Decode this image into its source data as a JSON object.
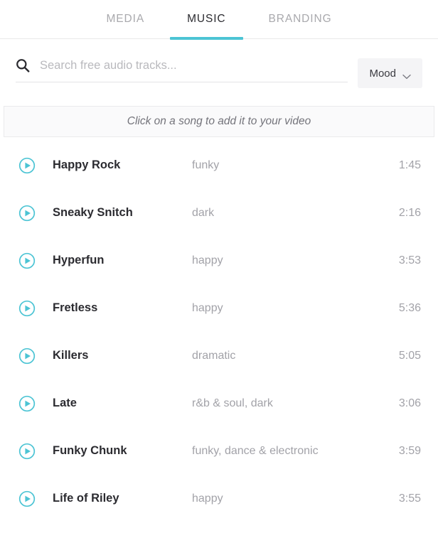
{
  "colors": {
    "accent": "#4cc4d4",
    "text_dark": "#2b2b30",
    "text_muted": "#a2a2a8",
    "tab_inactive": "#a9a9ad",
    "border": "#e9e9e9",
    "banner_bg": "#fafafb",
    "mood_btn_bg": "#f4f4f6"
  },
  "tabs": [
    {
      "label": "MEDIA",
      "active": false
    },
    {
      "label": "MUSIC",
      "active": true
    },
    {
      "label": "BRANDING",
      "active": false
    }
  ],
  "search": {
    "icon": "search-icon",
    "value": "",
    "placeholder": "Search free audio tracks..."
  },
  "filter": {
    "label": "Mood",
    "icon": "chevron-down-icon"
  },
  "hint": {
    "text": "Click on a song to add it to your video"
  },
  "tracks": [
    {
      "play_icon": "play-circle-icon",
      "title": "Happy Rock",
      "mood": "funky",
      "duration": "1:45"
    },
    {
      "play_icon": "play-circle-icon",
      "title": "Sneaky Snitch",
      "mood": "dark",
      "duration": "2:16"
    },
    {
      "play_icon": "play-circle-icon",
      "title": "Hyperfun",
      "mood": "happy",
      "duration": "3:53"
    },
    {
      "play_icon": "play-circle-icon",
      "title": "Fretless",
      "mood": "happy",
      "duration": "5:36"
    },
    {
      "play_icon": "play-circle-icon",
      "title": "Killers",
      "mood": "dramatic",
      "duration": "5:05"
    },
    {
      "play_icon": "play-circle-icon",
      "title": "Late",
      "mood": "r&b & soul, dark",
      "duration": "3:06"
    },
    {
      "play_icon": "play-circle-icon",
      "title": "Funky Chunk",
      "mood": "funky, dance & electronic",
      "duration": "3:59"
    },
    {
      "play_icon": "play-circle-icon",
      "title": "Life of Riley",
      "mood": "happy",
      "duration": "3:55"
    }
  ]
}
